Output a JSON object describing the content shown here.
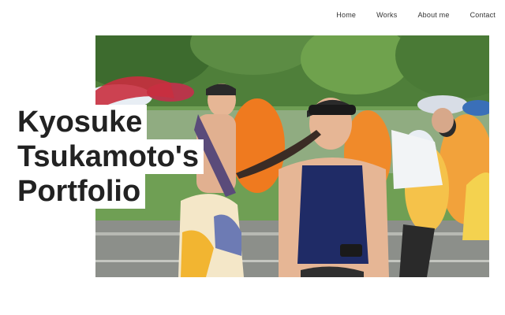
{
  "nav": {
    "items": [
      {
        "label": "Home"
      },
      {
        "label": "Works"
      },
      {
        "label": "About me"
      },
      {
        "label": "Contact"
      }
    ]
  },
  "hero": {
    "title_lines": [
      "Kyosuke",
      "Tsukamoto's",
      "Portfolio"
    ],
    "image_description_icon": "photo-festival-dancers"
  },
  "colors": {
    "text": "#222222",
    "background": "#ffffff",
    "nav_text": "#333333"
  }
}
